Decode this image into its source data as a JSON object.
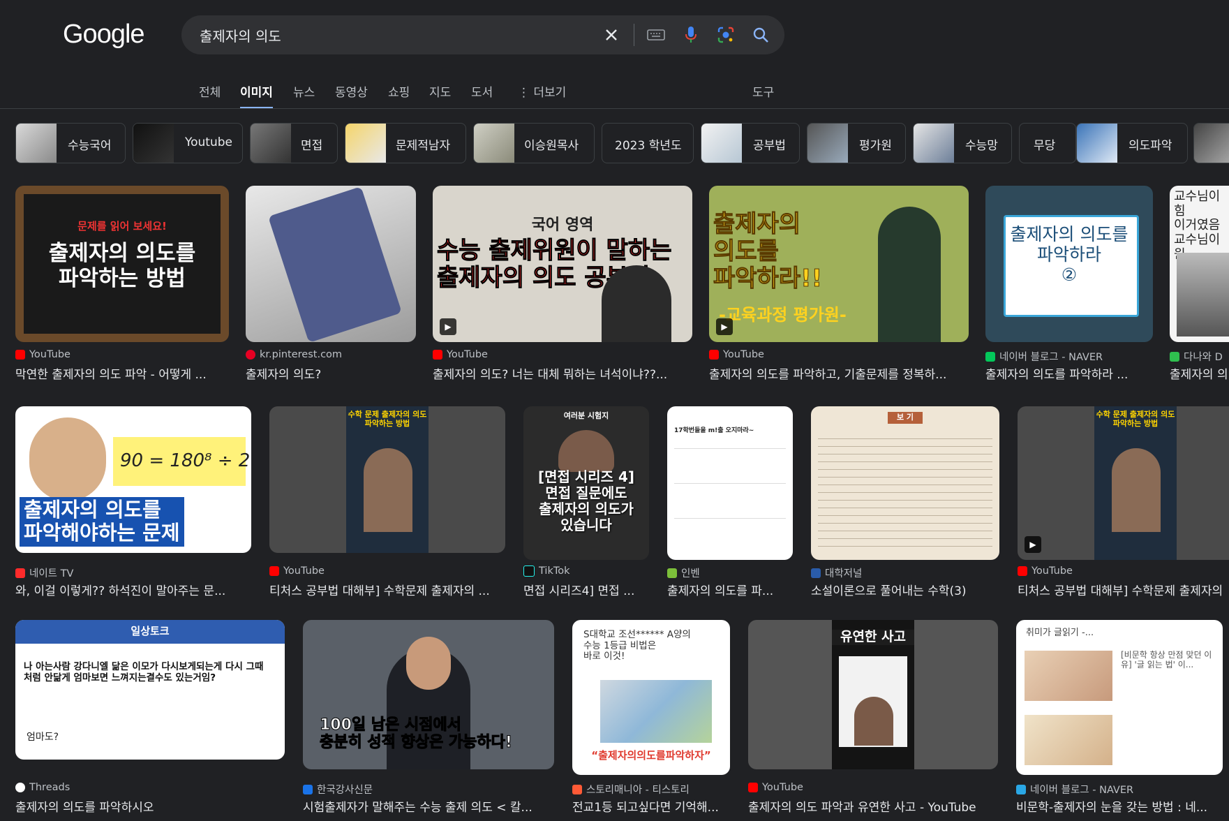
{
  "logo": "Google",
  "search": {
    "query": "출제자의 의도"
  },
  "tabs": [
    "전체",
    "이미지",
    "뉴스",
    "동영상",
    "쇼핑",
    "지도",
    "도서",
    "더보기",
    "도구"
  ],
  "chips": [
    "수능국어",
    "Youtube",
    "면접",
    "문제적남자",
    "이승원목사",
    "2023 학년도",
    "공부법",
    "평가원",
    "수능망",
    "무당",
    "의도파악"
  ],
  "results": [
    {
      "source": "YouTube",
      "title": "막연한 출제자의 의도 파악 - 어떻게 ...",
      "thumb_text": "출제자의 의도를\n파악하는 방법",
      "thumb_sub": "문제를 읽어 보세요!"
    },
    {
      "source": "kr.pinterest.com",
      "title": "출제자의 의도?"
    },
    {
      "source": "YouTube",
      "title": "출제자의 의도? 너는 대체 뭐하는 녀석이냐??...",
      "thumb_text": "수능 출제위원이 말하는\n출제자의 의도 공부법",
      "thumb_sub": "국어 영역"
    },
    {
      "source": "YouTube",
      "title": "출제자의 의도를 파악하고, 기출문제를 정복하...",
      "thumb_text": "출제자의\n의도를\n파악하라!!",
      "thumb_sub": "-교육과정 평가원-"
    },
    {
      "source": "네이버 블로그 - NAVER",
      "title": "출제자의 의도를 파악하라 ...",
      "thumb_text": "출제자의 의도를\n파악하라\n②"
    },
    {
      "source": "다나와 D",
      "title": "출제자의 의",
      "thumb_text": "교수님이 힘\n이거였음\n교수님이원"
    },
    {
      "source": "네이트 TV",
      "title": "와, 이걸 이렇게?? 하석진이 말아주는 문...",
      "thumb_text": "출제자의 의도를\n파악해야하는 문제",
      "thumb_sub": "90 = 180⁸ ÷ 2"
    },
    {
      "source": "YouTube",
      "title": "티처스 공부법 대해부] 수학문제 출제자의 ...",
      "thumb_text": "수학 문제 출제자의 의도\n파악하는 방법"
    },
    {
      "source": "TikTok",
      "title": "면접 시리즈4] 면접 ...",
      "thumb_text": "[면접 시리즈 4]\n면접 질문에도\n출제자의 의도가\n있습니다",
      "thumb_sub": "여러분 시험지"
    },
    {
      "source": "인벤",
      "title": "출제자의 의도를 파...",
      "thumb_text": "17학번들을 m!출 오지마라~"
    },
    {
      "source": "대학저널",
      "title": "소설이론으로 풀어내는 수학(3)",
      "thumb_text": "보 기"
    },
    {
      "source": "YouTube",
      "title": "티처스 공부법 대해부] 수학문제 출제자의",
      "thumb_text": "수학 문제 출제자의 의도\n파악하는 방법"
    },
    {
      "source": "Threads",
      "title": "출제자의 의도를 파악하시오",
      "thumb_text": "나 아는사람 강다니엘 닮은 이모가 다시보게되는게 다시 그때\n처럼 안닮게 엄마보면 느껴지는결수도 있는거임?",
      "thumb_sub": "일상토크",
      "thumb_extra": "엄마도?"
    },
    {
      "source": "한국강사신문",
      "title": "시험출제자가 말해주는 수능 출제 의도 < 칼...",
      "thumb_text": "100일 남은 시점에서\n충분히 성적 향상은 가능하다!"
    },
    {
      "source": "스토리매니아 - 티스토리",
      "title": "전교1등 되고싶다면 기억해...",
      "thumb_text": "S대학교 조선****** A양의\n수능 1등급 비법은\n바로 이것!",
      "thumb_sub": "“출제자의의도를파악하자”"
    },
    {
      "source": "YouTube",
      "title": "출제자의 의도 파악과 유연한 사고 - YouTube",
      "thumb_text": "유연한 사고"
    },
    {
      "source": "네이버 블로그 - NAVER",
      "title": "비문학-출제자의 눈을 갖는 방법 : 네...",
      "thumb_text": "취미가 글읽기 -...",
      "thumb_sub": "[비문학 항상 만점 맞던 이유] '글 읽는 법' 이..."
    }
  ],
  "colors": {
    "bg": "#202124",
    "searchbar": "#303134",
    "accent": "#8ab4f8",
    "youtube": "#ff0000"
  }
}
